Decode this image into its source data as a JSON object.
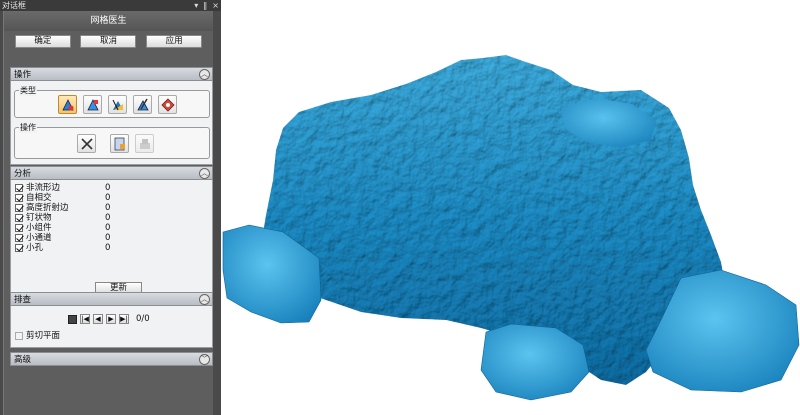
{
  "window": {
    "title": "对话框",
    "controls": [
      "▾",
      "‖",
      "×"
    ]
  },
  "dialog": {
    "title": "网格医生",
    "buttons": {
      "ok": "确定",
      "cancel": "取消",
      "apply": "应用"
    }
  },
  "operation_section": {
    "header": "操作",
    "type_group": {
      "label": "类型",
      "icons": [
        "auto-repair-icon",
        "fill-hole-icon",
        "trim-icon",
        "smooth-brush-icon",
        "pinwheel-icon"
      ]
    },
    "action_group": {
      "label": "操作",
      "icons": [
        "delete-x-icon",
        "repair-doc-icon",
        "stack-icon"
      ]
    }
  },
  "analysis_section": {
    "header": "分析",
    "items": [
      {
        "label": "非流形边",
        "value": "0",
        "checked": true
      },
      {
        "label": "自相交",
        "value": "0",
        "checked": true
      },
      {
        "label": "高度折射边",
        "value": "0",
        "checked": true
      },
      {
        "label": "钉状物",
        "value": "0",
        "checked": true
      },
      {
        "label": "小组件",
        "value": "0",
        "checked": true
      },
      {
        "label": "小通道",
        "value": "0",
        "checked": true
      },
      {
        "label": "小孔",
        "value": "0",
        "checked": true
      }
    ],
    "refresh_label": "更新"
  },
  "inspect_section": {
    "header": "排查",
    "nav": {
      "first": "|◀",
      "prev": "◀",
      "next": "▶",
      "last": "▶|"
    },
    "counter": "0/0",
    "clip_plane_label": "剪切平面",
    "clip_plane_checked": false
  },
  "advanced_section": {
    "header": "高级"
  },
  "colors": {
    "mesh": "#1d8fc9",
    "mesh_light": "#45b7e6",
    "mesh_dark": "#0b5f8f",
    "panel_bg": "#5e5e5e"
  }
}
